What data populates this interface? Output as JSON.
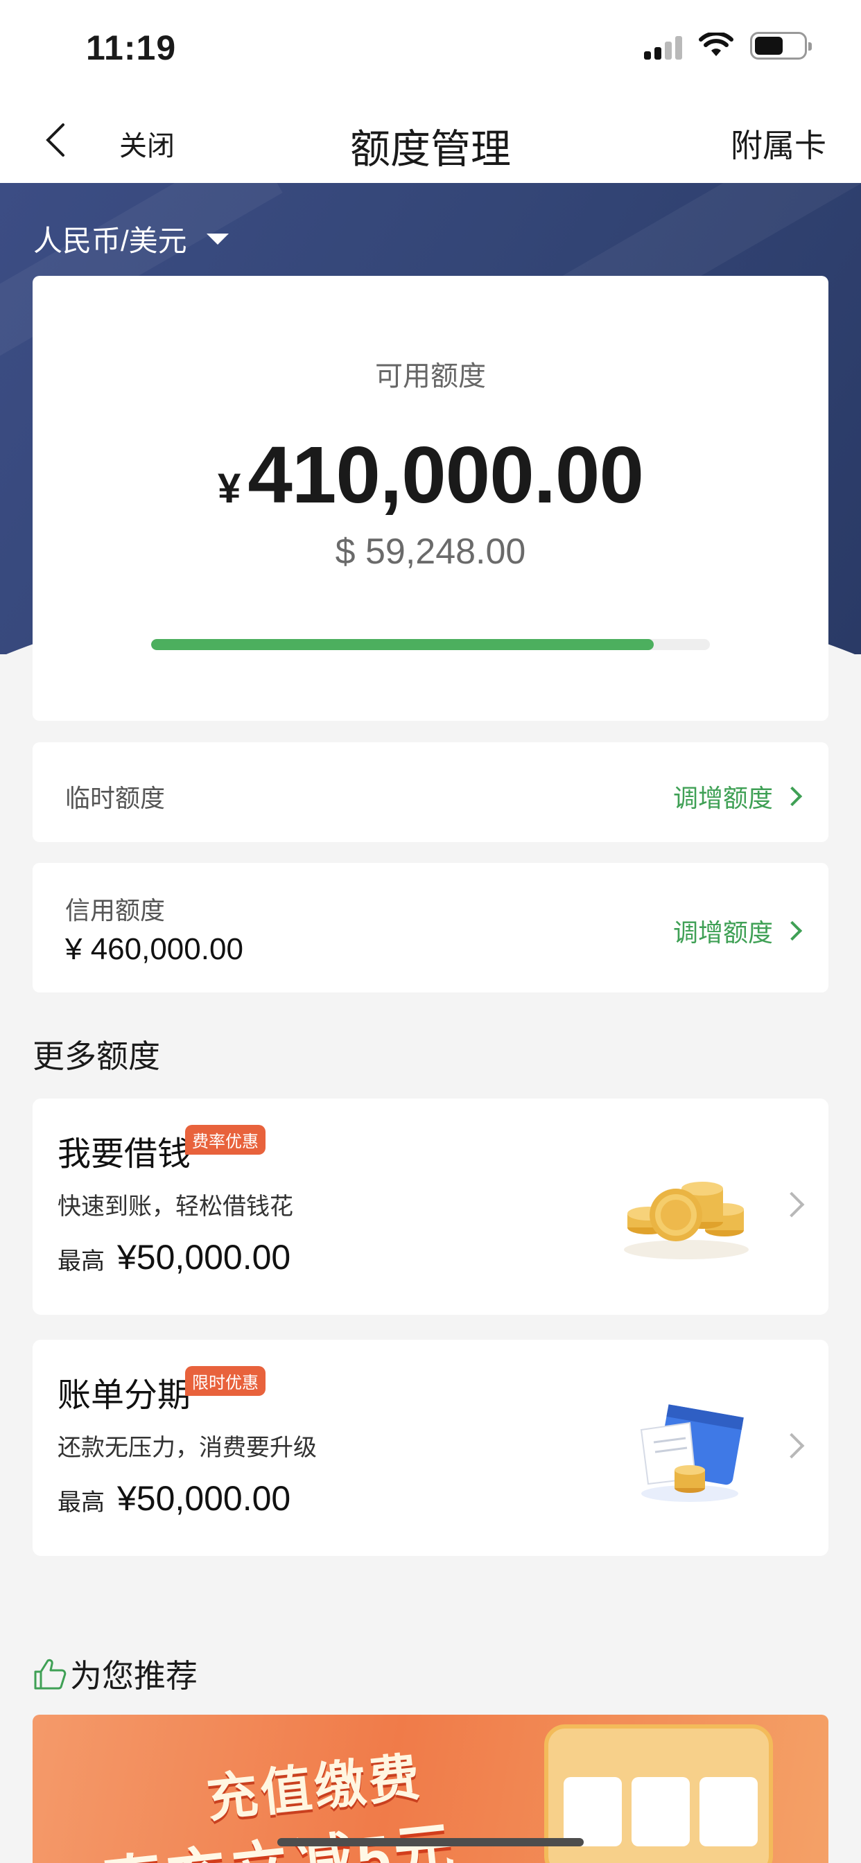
{
  "status_bar": {
    "time": "11:19"
  },
  "nav": {
    "close": "关闭",
    "title": "额度管理",
    "right": "附属卡"
  },
  "currency_selector": {
    "label": "人民币/美元"
  },
  "available": {
    "label": "可用额度",
    "symbol": "¥",
    "amount": "410,000.00",
    "usd": "$ 59,248.00",
    "progress_percent": 90,
    "progress_color": "#4caf5e"
  },
  "temporary": {
    "label": "临时额度",
    "action": "调增额度"
  },
  "credit": {
    "label": "信用额度",
    "value": "¥ 460,000.00",
    "action": "调增额度"
  },
  "more": {
    "title": "更多额度",
    "offers": [
      {
        "title": "我要借钱",
        "badge": "费率优惠",
        "desc": "快速到账，轻松借钱花",
        "max_label": "最高",
        "max_value": "¥50,000.00",
        "icon": "gold-coins-icon"
      },
      {
        "title": "账单分期",
        "badge": "限时优惠",
        "desc": "还款无压力，消费要升级",
        "max_label": "最高",
        "max_value": "¥50,000.00",
        "icon": "bill-card-icon"
      }
    ]
  },
  "recommend": {
    "title": "为您推荐",
    "icon": "thumbs-up-icon"
  },
  "colors": {
    "accent_green": "#3fa055",
    "badge_orange": "#e8623c",
    "hero_navy": "#344677"
  }
}
